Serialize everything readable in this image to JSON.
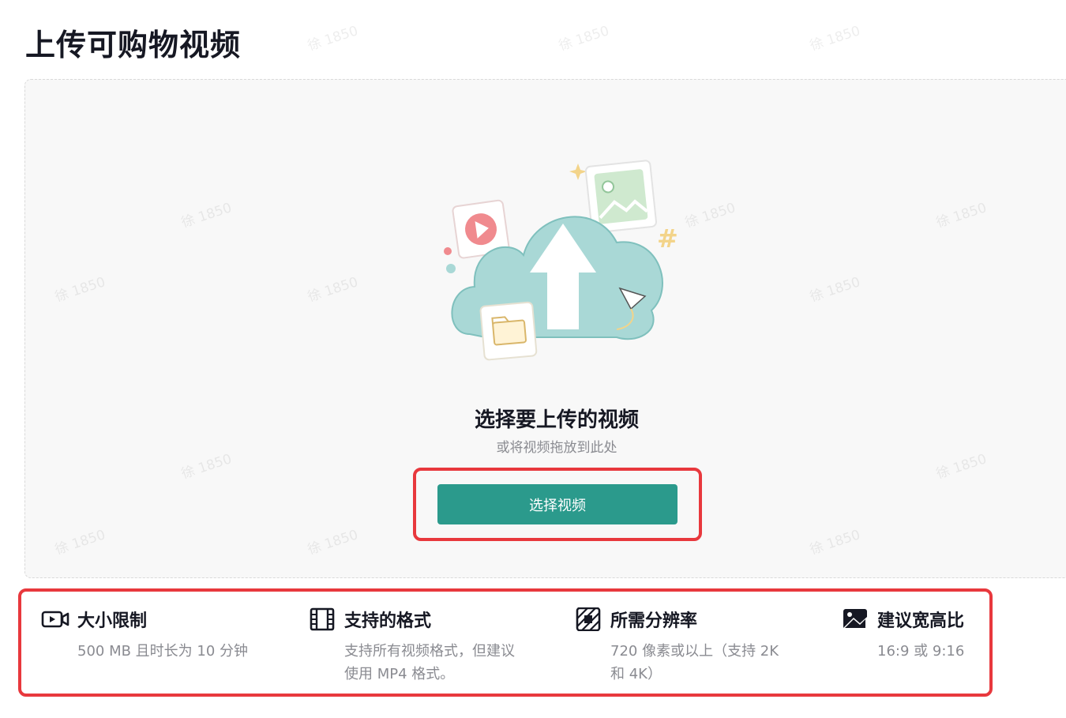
{
  "page": {
    "title": "上传可购物视频"
  },
  "upload": {
    "prompt_title": "选择要上传的视频",
    "prompt_sub": "或将视频拖放到此处",
    "button_label": "选择视频"
  },
  "requirements": [
    {
      "icon": "video-camera-icon",
      "title": "大小限制",
      "desc": "500 MB 且时长为 10 分钟"
    },
    {
      "icon": "film-strip-icon",
      "title": "支持的格式",
      "desc": "支持所有视频格式，但建议\n使用 MP4 格式。"
    },
    {
      "icon": "resolution-icon",
      "title": "所需分辨率",
      "desc": "720 像素或以上（支持 2K\n和 4K）"
    },
    {
      "icon": "aspect-ratio-icon",
      "title": "建议宽高比",
      "desc": "16:9 或 9:16"
    }
  ],
  "watermark_text": "徐 1850",
  "colors": {
    "accent": "#2b9a8c",
    "highlight": "#e8383d",
    "cloud": "#a9d8d6"
  }
}
